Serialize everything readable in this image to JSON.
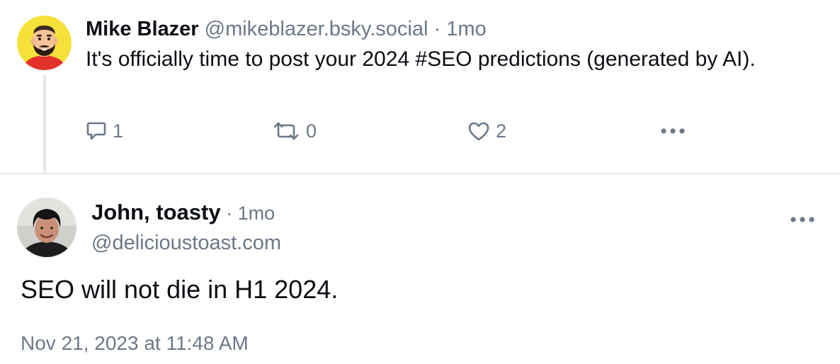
{
  "parent_post": {
    "author_name": "Mike Blazer",
    "author_handle": "@mikeblazer.bsky.social",
    "separator": " · ",
    "time": "1mo",
    "text": "It's officially time to post your 2024 #SEO predictions (generated by AI).",
    "actions": {
      "reply_count": "1",
      "repost_count": "0",
      "like_count": "2"
    },
    "avatar_bg": "#f6e13a"
  },
  "reply_post": {
    "author_name": "John, toasty",
    "separator": " · ",
    "time": "1mo",
    "author_handle": "@delicioustoast.com",
    "text": "SEO will not die in H1 2024.",
    "timestamp": "Nov 21, 2023 at 11:48 AM"
  },
  "icons": {
    "reply": "speech-bubble-icon",
    "repost": "repost-arrows-icon",
    "like": "heart-icon",
    "more": "ellipsis-icon"
  },
  "colors": {
    "muted_text": "#6b7889",
    "primary_text": "#0b0f14",
    "thread_line": "#e4e6eb",
    "divider": "#e7e9ec"
  }
}
